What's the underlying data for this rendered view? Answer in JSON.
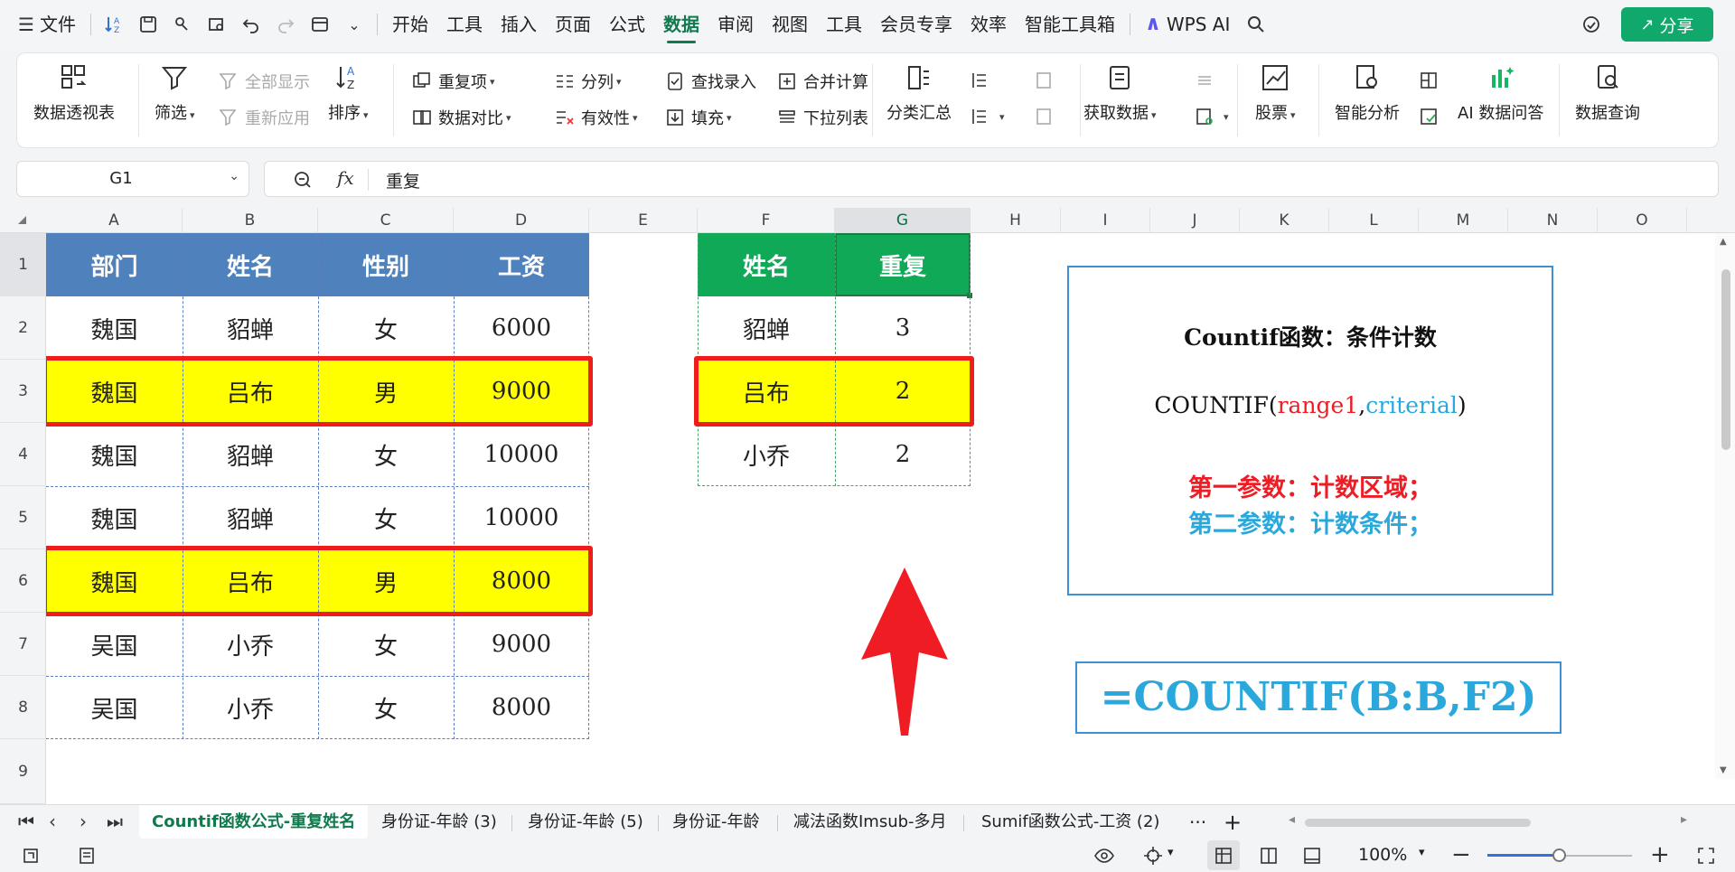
{
  "menubar": {
    "file_label": "文件",
    "menus": [
      "开始",
      "工具",
      "插入",
      "页面",
      "公式",
      "数据",
      "审阅",
      "视图",
      "工具",
      "会员专享",
      "效率",
      "智能工具箱"
    ],
    "active_menu": "数据",
    "wps_ai": "WPS AI",
    "share_label": "分享"
  },
  "ribbon": {
    "pivot_table": "数据透视表",
    "filter": "筛选",
    "show_all": "全部显示",
    "reapply": "重新应用",
    "sort": "排序",
    "duplicates": "重复项",
    "data_compare": "数据对比",
    "split_column": "分列",
    "validity": "有效性",
    "lookup_entry": "查找录入",
    "fill": "填充",
    "consolidate": "合并计算",
    "dropdown_list": "下拉列表",
    "subtotal": "分类汇总",
    "get_data": "获取数据",
    "stocks": "股票",
    "smart_analysis": "智能分析",
    "ai_data_qa": "AI 数据问答",
    "data_query": "数据查询"
  },
  "formula_bar": {
    "cell_ref": "G1",
    "fx": "fx",
    "content": "重复"
  },
  "sheet": {
    "columns": [
      "A",
      "B",
      "C",
      "D",
      "E",
      "F",
      "G",
      "H",
      "I",
      "J",
      "K",
      "L",
      "M",
      "N",
      "O"
    ],
    "selected_column": "G",
    "rows": [
      "1",
      "2",
      "3",
      "4",
      "5",
      "6",
      "7",
      "8",
      "9"
    ],
    "selected_row": "1",
    "main_table": {
      "headers": [
        "部门",
        "姓名",
        "性别",
        "工资"
      ],
      "rows": [
        [
          "魏国",
          "貂蝉",
          "女",
          "6000"
        ],
        [
          "魏国",
          "吕布",
          "男",
          "9000"
        ],
        [
          "魏国",
          "貂蝉",
          "女",
          "10000"
        ],
        [
          "魏国",
          "貂蝉",
          "女",
          "10000"
        ],
        [
          "魏国",
          "吕布",
          "男",
          "8000"
        ],
        [
          "吴国",
          "小乔",
          "女",
          "9000"
        ],
        [
          "吴国",
          "小乔",
          "女",
          "8000"
        ]
      ],
      "highlighted_rows": [
        2,
        5
      ]
    },
    "result_table": {
      "headers": [
        "姓名",
        "重复"
      ],
      "rows": [
        [
          "貂蝉",
          "3"
        ],
        [
          "吕布",
          "2"
        ],
        [
          "小乔",
          "2"
        ]
      ],
      "highlighted_rows": [
        2
      ]
    },
    "info_box": {
      "title": "Countif函数：条件计数",
      "syntax_prefix": "COUNTIF(",
      "syntax_arg1": "range1",
      "syntax_comma": ",",
      "syntax_arg2": "criterial",
      "syntax_suffix": ")",
      "param1": "第一参数：计数区域；",
      "param2": "第二参数：计数条件；"
    },
    "formula_example": "=COUNTIF(B:B,F2)"
  },
  "tabs": {
    "items": [
      "Countif函数公式-重复姓名",
      "身份证-年龄 (3)",
      "身份证-年龄 (5)",
      "身份证-年龄",
      "减法函数Imsub-多月",
      "Sumif函数公式-工资 (2)"
    ],
    "active_index": 0,
    "more": "···",
    "add": "+"
  },
  "statusbar": {
    "zoom": "100%"
  },
  "colors": {
    "header_blue": "#4f81bd",
    "header_green": "#10a957",
    "highlight_yellow": "#ffff00",
    "highlight_border": "#ef1c1c",
    "accent_green": "#0f7a4e",
    "param1_red": "#ee1c24",
    "param2_blue": "#2aa8dc"
  }
}
